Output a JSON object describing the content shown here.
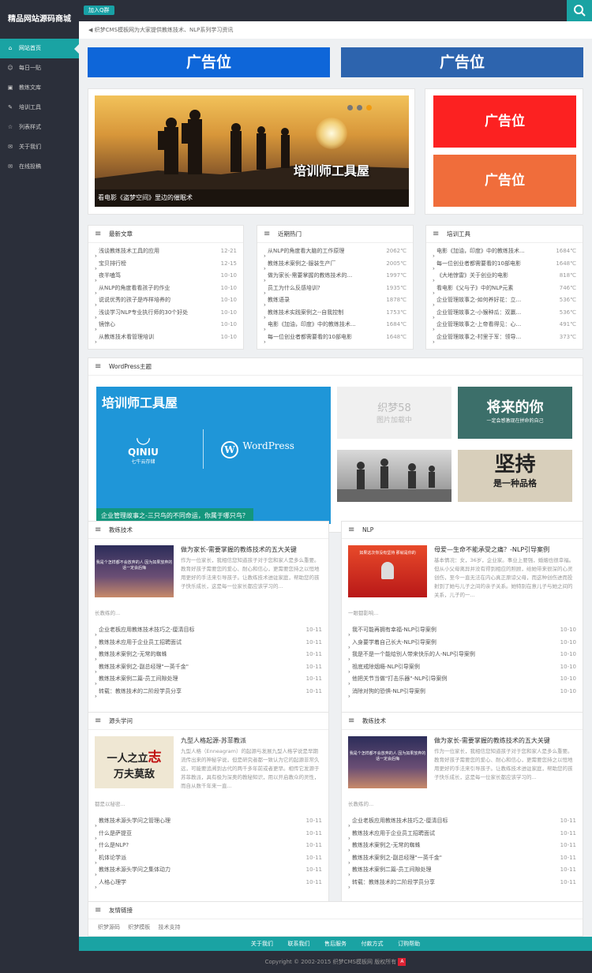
{
  "site": {
    "logo": "精品网站源码商城",
    "qq_label": "加入Q群",
    "notice": "织梦CMS模板网为大家提供教练技术、NLP系列学习资讯"
  },
  "nav": [
    {
      "label": "网站首页",
      "icon": "home-icon",
      "glyph": "⌂"
    },
    {
      "label": "每日一贴",
      "icon": "smile-icon",
      "glyph": "☺"
    },
    {
      "label": "教练文库",
      "icon": "image-icon",
      "glyph": "▣"
    },
    {
      "label": "培训工具",
      "icon": "pencil-icon",
      "glyph": "✎"
    },
    {
      "label": "列表样式",
      "icon": "star-icon",
      "glyph": "☆"
    },
    {
      "label": "关于我们",
      "icon": "comments-icon",
      "glyph": "✉"
    },
    {
      "label": "在线投稿",
      "icon": "comments-icon",
      "glyph": "✉"
    }
  ],
  "ads": {
    "top_left": "广告位",
    "top_right": "广告位",
    "side_top": "广告位",
    "side_bottom": "广告位"
  },
  "slider": {
    "overlay": "培训师工具屋",
    "caption": "看电影《盗梦空间》里边的催眠术"
  },
  "latest": {
    "title": "最新文章",
    "items": [
      {
        "t": "浅谈教练技术工具的应用",
        "d": "12-21"
      },
      {
        "t": "宝贝排行榜",
        "d": "12-15"
      },
      {
        "t": "夜半嗑笃",
        "d": "10-10"
      },
      {
        "t": "从NLP的角度看看孩子的作业",
        "d": "10-10"
      },
      {
        "t": "说说优秀的孩子是咋样培养的",
        "d": "10-10"
      },
      {
        "t": "浅谈学习NLP专业执行师的30个好处",
        "d": "10-10"
      },
      {
        "t": "镜惊心",
        "d": "10-10"
      },
      {
        "t": "从教练技术看管理培训",
        "d": "10-10"
      }
    ]
  },
  "hot": {
    "title": "近期热门",
    "items": [
      {
        "t": "从NLP的角度看大脑的工作原理",
        "d": "2062℃"
      },
      {
        "t": "教练技术案例之-服装生产厂",
        "d": "2005℃"
      },
      {
        "t": "做为家长-需要掌握的教练技术的...",
        "d": "1997℃"
      },
      {
        "t": "员工为什么反感培训?",
        "d": "1935℃"
      },
      {
        "t": "教练语录",
        "d": "1878℃"
      },
      {
        "t": "教练技术实践案例之--自我控制",
        "d": "1753℃"
      },
      {
        "t": "电影《加油，印度》中的教练技术...",
        "d": "1684℃"
      },
      {
        "t": "每一位创业者都需要看的10部电影",
        "d": "1648℃"
      }
    ]
  },
  "tools": {
    "title": "培训工具",
    "items": [
      {
        "t": "电影《加油，印度》中的教练技术...",
        "d": "1684℃"
      },
      {
        "t": "每一位创业者都需要看的10部电影",
        "d": "1648℃"
      },
      {
        "t": "《大地惊雷》关于创业的电影",
        "d": "818℃"
      },
      {
        "t": "看电影《父与子》中的NLP元素",
        "d": "746℃"
      },
      {
        "t": "企业管理故事之-如何养好花：立...",
        "d": "536℃"
      },
      {
        "t": "企业管理故事之-小猴种瓜：双赢...",
        "d": "536℃"
      },
      {
        "t": "企业管理故事之-上帝看得见：心...",
        "d": "491℃"
      },
      {
        "t": "企业管理故事之-村里于军：领导...",
        "d": "373℃"
      }
    ]
  },
  "wp": {
    "title": "WordPress主题",
    "big_title": "培训师工具屋",
    "qiniu": "QINIU",
    "qiniu_sub": "七牛云存储",
    "wordpress": "WordPress",
    "caption": "企业管理故事之-三只鸟的不同命运，你属于哪只鸟？",
    "placeholder": "织梦58",
    "placeholder_sub": "图片加载中",
    "future": "将来的你",
    "future_sub": "一定会感激现在拼命的自己",
    "persist": "坚持",
    "persist_sub": "是一种品格"
  },
  "coach1": {
    "title": "教练技术",
    "ft": "做为家长-需要掌握的教练技术的五大关键",
    "fd": "作为一位家长，我相信您知道孩子对于您和家人是多么重要。教育好孩子需要您的爱心、耐心和信心，更需要您持之以恒地用更好的手法来引导孩子。让教练技术进驻家庭，帮助您的孩子快乐成长，这是每一位家长都应该学习的...",
    "fd2": "长教练的...",
    "img_text": "我是个怎样都不会放弃的人 因为如果放弃的话一定会后悔",
    "items": [
      {
        "t": "企业老板应用教练技术技巧之-厘清目标",
        "d": "10-11"
      },
      {
        "t": "教练技术应用于企业员工招聘面试",
        "d": "10-11"
      },
      {
        "t": "教练技术案例之-无常的蜘蛛",
        "d": "10-11"
      },
      {
        "t": "教练技术案例之-副总经理\"一英千金\"",
        "d": "10-11"
      },
      {
        "t": "教练技术案例二篇-员工间隙处理",
        "d": "10-11"
      },
      {
        "t": "转载：教练技术的二阶段学员分享",
        "d": "10-11"
      }
    ]
  },
  "nlp": {
    "title": "NLP",
    "ft": "母爱—生命不能承受之痛？-NLP引导案例",
    "fd": "基本情况：女，36岁，企业家。事业上要强，婚姻也很幸福。但从小父母离异并没有得到相应的照顾，给她带来很深的心灵创伤，至今一直无法在内心真正原谅父母，而这种创伤进而投射到了她与儿子之间的亲子关系。她特别在意儿子与她之间的关系，儿子的一...",
    "fd2": "一眼都影响...",
    "img_text": "如果这次你没有坚持 那就是你的",
    "items": [
      {
        "t": "我不可能再拥有幸福-NLP引导案例",
        "d": "10-10"
      },
      {
        "t": "入身要学着自己长大-NLP引导案例",
        "d": "10-10"
      },
      {
        "t": "我是不是一个能给别人带来快乐的人-NLP引导案例",
        "d": "10-10"
      },
      {
        "t": "祖底戒除烟瘾-NLP引导案例",
        "d": "10-10"
      },
      {
        "t": "他把关节当做\"打击乐器\"-NLP引导案例",
        "d": "10-10"
      },
      {
        "t": "消除对狗的恐惧-NLP引导案例",
        "d": "10-10"
      }
    ]
  },
  "source": {
    "title": "源头学问",
    "ft": "九型人格起源-苏菲教派",
    "fd": "九型人格（Enneagram）的起源与发展九型人格学说是早期流传出来的神秘学说，但是研究者都一致认为它的起源非常久远，可能要追溯到古代的两千多年前或者更早。相传它发源于苏菲教派，具有极为深奥的教秘知识，用以开启教众的灵性，而自从数千年来一直...",
    "fd2": "都是以秘密...",
    "img_text1": "一人之立",
    "img_text2": "志",
    "img_text3": "万夫莫敌",
    "items": [
      {
        "t": "教练技术源头学问之管理心理",
        "d": "10-11"
      },
      {
        "t": "什么是萨提亚",
        "d": "10-11"
      },
      {
        "t": "什么是NLP?",
        "d": "10-11"
      },
      {
        "t": "机体论学派",
        "d": "10-11"
      },
      {
        "t": "教练技术源头学问之集体动力",
        "d": "10-11"
      },
      {
        "t": "人格心理学",
        "d": "10-11"
      }
    ]
  },
  "coach2": {
    "title": "教练技术",
    "ft": "做为家长-需要掌握的教练技术的五大关键",
    "fd": "作为一位家长，我相信您知道孩子对于您和家人是多么重要。教育好孩子需要您的爱心、耐心和信心，更需要您持之以恒地用更好的手法来引导孩子。让教练技术进驻家庭，帮助您的孩子快乐成长，这是每一位家长都应该学习的...",
    "fd2": "长教练的...",
    "img_text": "我是个怎样都不会放弃的人 因为如果放弃的话一定会后悔",
    "items": [
      {
        "t": "企业老板应用教练技术技巧之-厘清目标",
        "d": "10-11"
      },
      {
        "t": "教练技术应用于企业员工招聘面试",
        "d": "10-11"
      },
      {
        "t": "教练技术案例之-无常的蜘蛛",
        "d": "10-11"
      },
      {
        "t": "教练技术案例之-副总经理\"一英千金\"",
        "d": "10-11"
      },
      {
        "t": "教练技术案例二篇-员工间隙处理",
        "d": "10-11"
      },
      {
        "t": "转载：教练技术的二阶段学员分享",
        "d": "10-11"
      }
    ]
  },
  "links": {
    "title": "友情链接",
    "items": [
      "织梦源码",
      "织梦模板",
      "技术支持"
    ]
  },
  "footer": {
    "nav": [
      "关于我们",
      "联系我们",
      "售后服务",
      "付款方式",
      "订购帮助"
    ],
    "copy": "Copyright © 2002-2015 织梦CMS模板网 版权所有"
  }
}
